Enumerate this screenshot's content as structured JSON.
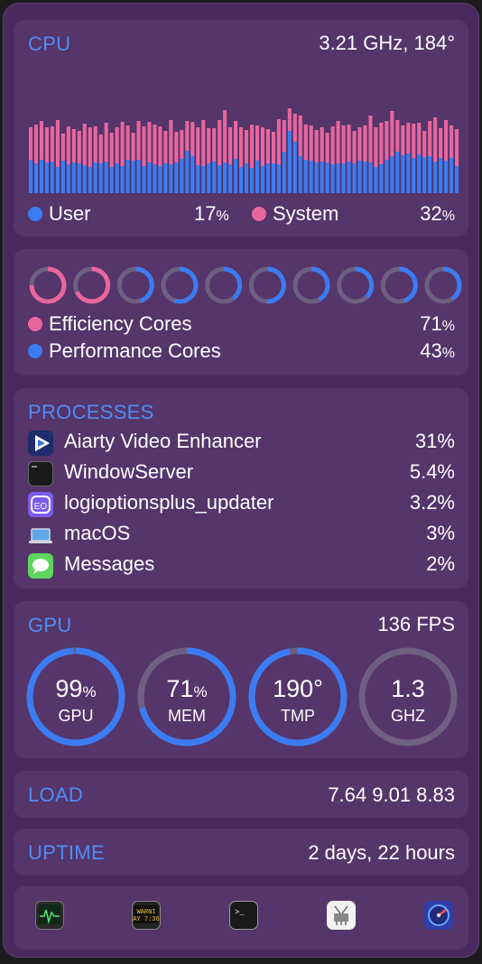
{
  "cpu": {
    "title": "CPU",
    "freq_temp": "3.21 GHz, 184°",
    "user_label": "User",
    "user_value": "17",
    "system_label": "System",
    "system_value": "32",
    "history_user": [
      0.37,
      0.33,
      0.37,
      0.34,
      0.35,
      0.29,
      0.36,
      0.32,
      0.34,
      0.33,
      0.31,
      0.29,
      0.34,
      0.33,
      0.35,
      0.29,
      0.33,
      0.3,
      0.37,
      0.36,
      0.37,
      0.3,
      0.34,
      0.32,
      0.3,
      0.33,
      0.32,
      0.34,
      0.38,
      0.47,
      0.41,
      0.31,
      0.3,
      0.33,
      0.35,
      0.31,
      0.34,
      0.32,
      0.38,
      0.29,
      0.33,
      0.28,
      0.36,
      0.3,
      0.33,
      0.33,
      0.32,
      0.46,
      0.69,
      0.57,
      0.41,
      0.37,
      0.36,
      0.34,
      0.35,
      0.34,
      0.32,
      0.33,
      0.33,
      0.35,
      0.33,
      0.36,
      0.35,
      0.34,
      0.29,
      0.32,
      0.37,
      0.41,
      0.46,
      0.42,
      0.44,
      0.39,
      0.43,
      0.4,
      0.41,
      0.35,
      0.39,
      0.36,
      0.39,
      0.3
    ],
    "history_total": [
      0.73,
      0.76,
      0.8,
      0.73,
      0.74,
      0.81,
      0.66,
      0.74,
      0.71,
      0.69,
      0.77,
      0.73,
      0.74,
      0.65,
      0.78,
      0.67,
      0.73,
      0.79,
      0.75,
      0.67,
      0.8,
      0.74,
      0.79,
      0.76,
      0.74,
      0.69,
      0.81,
      0.68,
      0.7,
      0.8,
      0.79,
      0.73,
      0.81,
      0.72,
      0.72,
      0.81,
      0.92,
      0.73,
      0.8,
      0.73,
      0.7,
      0.76,
      0.75,
      0.73,
      0.71,
      0.68,
      0.82,
      0.81,
      0.94,
      0.88,
      0.86,
      0.76,
      0.75,
      0.7,
      0.73,
      0.67,
      0.74,
      0.8,
      0.75,
      0.76,
      0.69,
      0.73,
      0.75,
      0.86,
      0.73,
      0.78,
      0.8,
      0.91,
      0.81,
      0.75,
      0.78,
      0.77,
      0.78,
      0.69,
      0.8,
      0.84,
      0.72,
      0.81,
      0.75,
      0.71
    ]
  },
  "cores": {
    "efficiency_label": "Efficiency Cores",
    "efficiency_value": "71",
    "performance_label": "Performance Cores",
    "performance_value": "43",
    "rings": [
      {
        "type": "efficiency",
        "level": 0.75
      },
      {
        "type": "efficiency",
        "level": 0.68
      },
      {
        "type": "performance",
        "level": 0.45
      },
      {
        "type": "performance",
        "level": 0.55
      },
      {
        "type": "performance",
        "level": 0.4
      },
      {
        "type": "performance",
        "level": 0.5
      },
      {
        "type": "performance",
        "level": 0.42
      },
      {
        "type": "performance",
        "level": 0.38
      },
      {
        "type": "performance",
        "level": 0.45
      },
      {
        "type": "performance",
        "level": 0.4
      }
    ]
  },
  "processes": {
    "title": "PROCESSES",
    "items": [
      {
        "name": "Aiarty Video Enhancer",
        "value": "31%",
        "icon": "aiarty-icon"
      },
      {
        "name": "WindowServer",
        "value": "5.4%",
        "icon": "terminal-window-icon"
      },
      {
        "name": "logioptionsplus_updater",
        "value": "3.2%",
        "icon": "logi-options-icon"
      },
      {
        "name": "macOS",
        "value": "3%",
        "icon": "laptop-icon"
      },
      {
        "name": "Messages",
        "value": "2%",
        "icon": "messages-icon"
      }
    ]
  },
  "gpu": {
    "title": "GPU",
    "fps": "136 FPS",
    "gauges": [
      {
        "value": "99",
        "unit": "%",
        "label": "GPU",
        "level": 0.99
      },
      {
        "value": "71",
        "unit": "%",
        "label": "MEM",
        "level": 0.71
      },
      {
        "value": "190°",
        "unit": "",
        "label": "TMP",
        "level": 0.97
      },
      {
        "value": "1.3",
        "unit": "",
        "label": "GHZ",
        "level": 0.0
      }
    ]
  },
  "load": {
    "title": "LOAD",
    "value": "7.64 9.01 8.83"
  },
  "uptime": {
    "title": "UPTIME",
    "value": "2 days, 22 hours"
  },
  "dock": {
    "icons": [
      "activity-monitor-icon",
      "console-icon",
      "terminal-icon",
      "system-information-icon",
      "istat-menus-icon"
    ],
    "console_text_1": "WARNI",
    "console_text_2": "AY 7:36",
    "terminal_text": ">_"
  },
  "colors": {
    "accent_blue": "#3b7cf2",
    "system_pink": "#e8669e",
    "ring_track": "#6e6080",
    "header_blue": "#4f8df5"
  }
}
